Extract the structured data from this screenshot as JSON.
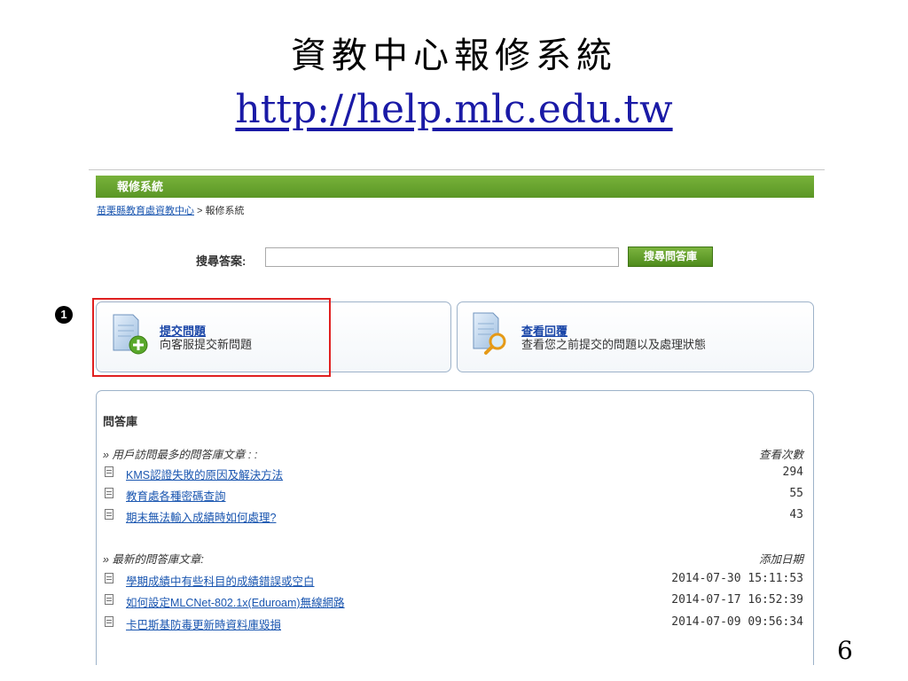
{
  "slide": {
    "title": "資教中心報修系統",
    "url": "http://help.mlc.edu.tw",
    "page_number": "6",
    "marker": "1"
  },
  "app": {
    "header_title": "報修系統",
    "breadcrumb_link": "苗栗縣教育處資教中心",
    "breadcrumb_rest": " > 報修系統"
  },
  "search": {
    "label": "搜尋答案:",
    "value": "",
    "button": "搜尋問答庫"
  },
  "actions": [
    {
      "title": "提交問題",
      "desc": "向客服提交新問題"
    },
    {
      "title": "查看回覆",
      "desc": "查看您之前提交的問題以及處理狀態"
    }
  ],
  "faq": {
    "title": "問答庫",
    "popular": {
      "heading": "» 用戶訪問最多的問答庫文章 : :",
      "col": "查看次數",
      "rows": [
        {
          "title": "KMS認證失敗的原因及解決方法",
          "value": "294"
        },
        {
          "title": "教育處各種密碼查詢",
          "value": "55"
        },
        {
          "title": "期末無法輸入成績時如何處理?",
          "value": "43"
        }
      ]
    },
    "latest": {
      "heading": "» 最新的問答庫文章:",
      "col": "添加日期",
      "rows": [
        {
          "title": "學期成績中有些科目的成績錯誤或空白",
          "value": "2014-07-30 15:11:53"
        },
        {
          "title": "如何設定MLCNet-802.1x(Eduroam)無線網路",
          "value": "2014-07-17 16:52:39"
        },
        {
          "title": "卡巴斯基防毒更新時資料庫毀損",
          "value": "2014-07-09 09:56:34"
        }
      ]
    }
  },
  "colors": {
    "green": "#5a9625",
    "link": "#1a56b0",
    "highlight": "#e02020"
  }
}
